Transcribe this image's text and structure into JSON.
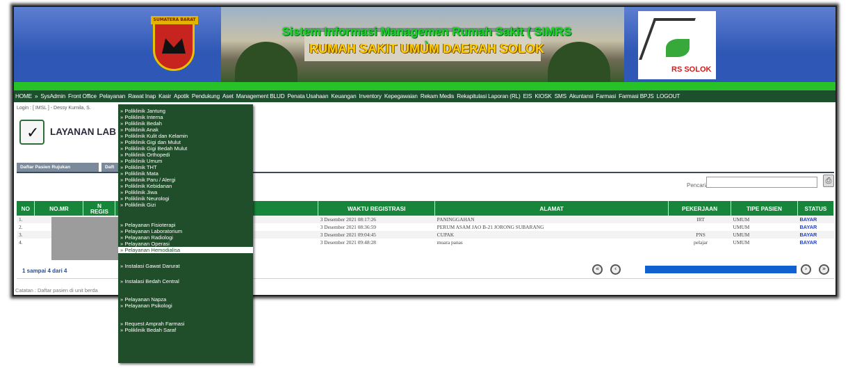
{
  "header": {
    "emblem_text": "SUMATERA BARAT",
    "title_line1": "Sistem Informasi Managemen Rumah Sakit ( SIMRS )",
    "title_line2": "RUMAH SAKIT UMUM DAERAH SOLOK",
    "logo_text": "RS SOLOK"
  },
  "nav": {
    "items": [
      "HOME",
      "»",
      "SysAdmin",
      "Front Office",
      "Pelayanan",
      "Rawat Inap",
      "Kasir",
      "Apotik",
      "Pendukung",
      "Aset",
      "Management BLUD",
      "Penata Usahaan",
      "Keuangan",
      "Inventory",
      "Kepegawaian",
      "Rekam Medis",
      "Rekapitulasi Laporan (RL)",
      "EIS",
      "KIOSK",
      "SMS",
      "Akuntansi",
      "Farmasi",
      "Farmasi BPJS",
      "LOGOUT"
    ]
  },
  "login_text": "Login : [ IMSL ] - Dessy Kurnila, S.",
  "page_title": "LAYANAN LAB",
  "tabs": [
    "Daftar Pasien Rujukan",
    "Daft"
  ],
  "search": {
    "label": "Pencarian :",
    "value": ""
  },
  "table": {
    "headers": [
      "NO",
      "NO.MR",
      "N\nREGIS",
      "N",
      "WAKTU REGISTRASI",
      "ALAMAT",
      "PEKERJAAN",
      "TIPE PASIEN",
      "STATUS"
    ],
    "rows": [
      {
        "no": "1.",
        "waktu": "3 Desember 2021 08:17:26",
        "alamat": "PANINGGAHAN",
        "pekerjaan": "IRT",
        "tipe": "UMUM",
        "status": "BAYAR"
      },
      {
        "no": "2.",
        "waktu": "3 Desember 2021 08:36:59",
        "alamat": "PERUM ASAM JAO B-21 JORONG SUBARANG",
        "pekerjaan": "",
        "tipe": "UMUM",
        "status": "BAYAR"
      },
      {
        "no": "3.",
        "waktu": "3 Desember 2021 09:04:45",
        "alamat": "CUPAK",
        "pekerjaan": "PNS",
        "tipe": "UMUM",
        "status": "BAYAR"
      },
      {
        "no": "4.",
        "waktu": "3 Desember 2021 09:48:28",
        "alamat": "muara panas",
        "pekerjaan": "pelajar",
        "tipe": "UMUM",
        "status": "BAYAR"
      }
    ]
  },
  "pager": {
    "info": "1 sampai 4 dari 4",
    "progress": 1.0
  },
  "footnote": "Catatan : Daftar pasien di unit berda",
  "menu": {
    "items": [
      "» Poliklinik Jantung",
      "» Poliklinik Interna",
      "» Poliklinik Bedah",
      "» Poliklinik Anak",
      "» Poliklinik Kulit dan Kelamin",
      "» Poliklinik Gigi dan Mulut",
      "» Poliklinik Gigi Bedah Mulut",
      "» Poliklinik Orthopedi",
      "» Poliklinik Umum",
      "» Poliklinik THT",
      "» Poliklinik Mata",
      "» Poliklinik Paru / Alergi",
      "» Poliklinik Kebidanan",
      "» Poliklinik Jiwa",
      "» Poliklinik Neurologi",
      "» Poliklinik Gizi",
      "» Pelayanan Fisioterapi",
      "» Pelayanan Laboratorium",
      "» Pelayanan Radiologi",
      "» Pelayanan Operasi",
      "» Pelayanan Hemodialisa",
      "» Instalasi Gawat Darurat",
      "» Instalasi Bedah Central",
      "» Pelayanan Napza",
      "» Pelayanan Psikologi",
      "» Request Amprah Farmasi",
      "» Poliklinik Bedah Saraf"
    ],
    "active_index": 20
  },
  "colors": {
    "nav_bg": "#1c4f2c",
    "header_bg": "#17863a",
    "menu_bg": "#214e2a",
    "status_link": "#2442c8",
    "progress": "#1160cf"
  }
}
